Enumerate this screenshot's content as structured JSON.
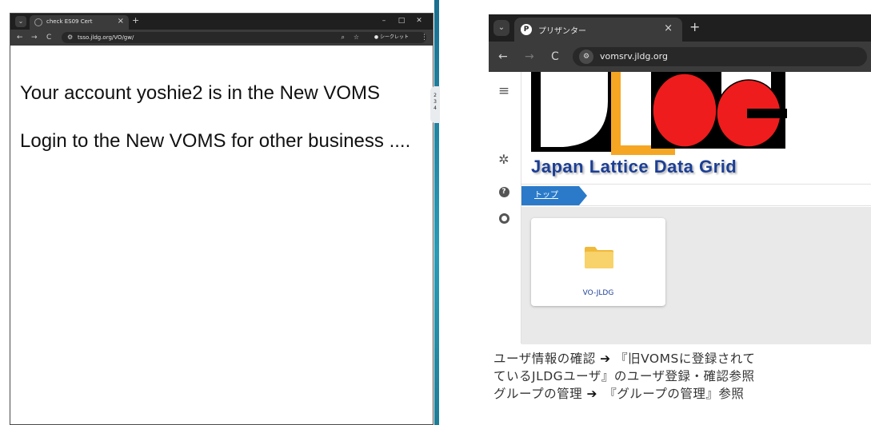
{
  "left_browser": {
    "tab_title": "check ES09 Cert",
    "tab_close": "×",
    "new_tab": "+",
    "window_controls": [
      "–",
      "□",
      "✕"
    ],
    "nav": {
      "back": "←",
      "forward": "→",
      "reload": "C"
    },
    "url": "tsso.jldg.org/VO/gw/",
    "incognito_label": "シークレット",
    "menu": "⋮",
    "messages": [
      "Your account yoshie2 is in the New VOMS",
      "Login to the New VOMS for other business ...."
    ]
  },
  "clock_peek_digits": [
    "2",
    "3",
    "4"
  ],
  "right_browser": {
    "tab_title": "プリザンター",
    "tab_favicon_letter": "P",
    "tab_close": "×",
    "new_tab": "+",
    "nav": {
      "back": "←",
      "forward": "→",
      "reload": "C"
    },
    "url": "vomsrv.jldg.org",
    "sidebar": {
      "menu_icon": "≡",
      "settings_icon": "✲",
      "help_icon": "?"
    },
    "logo_text": "Japan Lattice Data Grid",
    "breadcrumb": [
      "トップ"
    ],
    "cards": [
      {
        "label": "VO-JLDG"
      }
    ],
    "colors": {
      "logo_text": "#1c3f95",
      "breadcrumb": "#2a7ac9",
      "folder": "#f6c94f",
      "logo_red": "#ee1c1c",
      "logo_orange": "#f5a623"
    }
  },
  "note": {
    "line1_a": "ユーザ情報の確認",
    "line1_arrow": "➔",
    "line1_b": "『旧VOMSに登録されて",
    "line2": "ているJLDGユーザ』のユーザ登録・確認参照",
    "line3_a": "グループの管理",
    "line3_arrow": "➔",
    "line3_b": "『グループの管理』参照"
  }
}
